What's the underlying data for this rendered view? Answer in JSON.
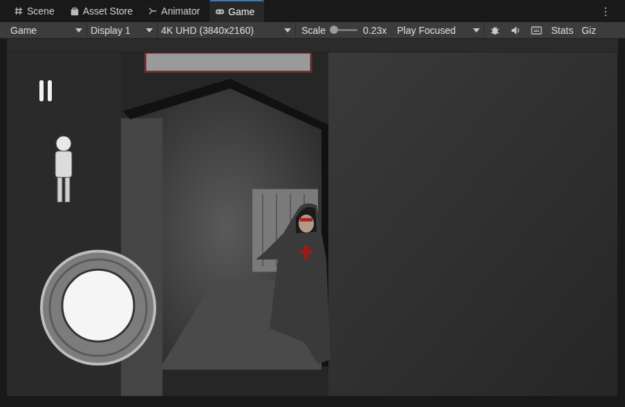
{
  "tabs": [
    {
      "label": "Scene",
      "selected": false
    },
    {
      "label": "Asset Store",
      "selected": false
    },
    {
      "label": "Animator",
      "selected": false
    },
    {
      "label": "Game",
      "selected": true
    }
  ],
  "menu_button": "⋮",
  "toolbar": {
    "view": "Game",
    "display": "Display 1",
    "resolution": "4K UHD (3840x2160)",
    "scale": {
      "label": "Scale",
      "level": 0.1,
      "reading": "0.23x"
    },
    "play_mode": "Play Focused",
    "stats": "Stats",
    "gizmos": "Giz"
  }
}
